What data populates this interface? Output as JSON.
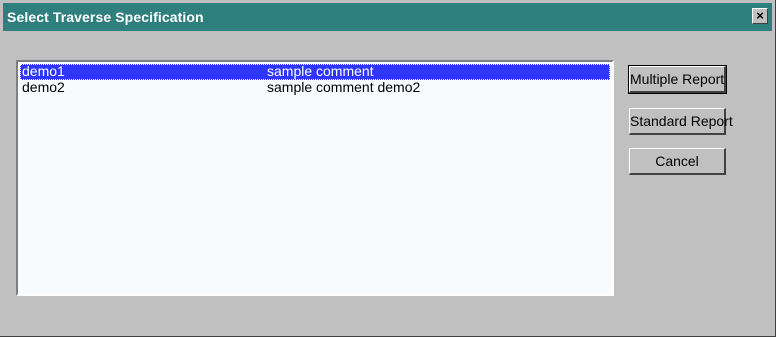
{
  "window": {
    "title": "Select Traverse Specification",
    "close_label": "×"
  },
  "list": {
    "rows": [
      {
        "name": "demo1",
        "comment": "sample comment",
        "selected": true
      },
      {
        "name": "demo2",
        "comment": "sample comment demo2",
        "selected": false
      }
    ]
  },
  "buttons": {
    "multiple_report": "Multiple Report",
    "standard_report": "Standard Report",
    "cancel": "Cancel"
  },
  "colors": {
    "titlebar": "#2f7f7f",
    "selection": "#2d35ff",
    "dialog_bg": "#c0c0c0"
  }
}
